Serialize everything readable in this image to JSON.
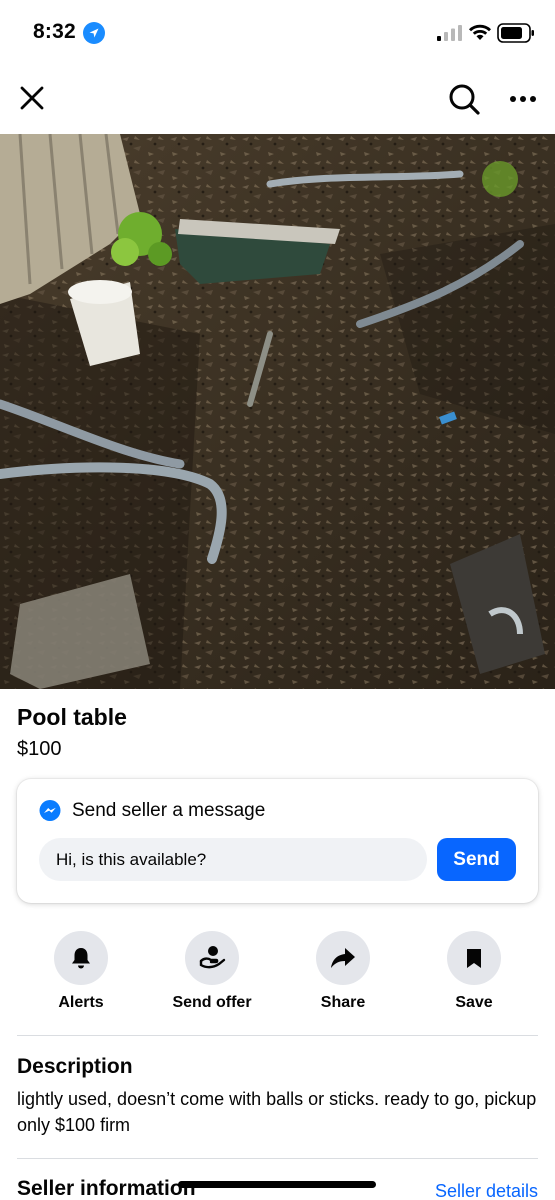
{
  "status_bar": {
    "time": "8:32",
    "icons": [
      "location-arrow-icon",
      "cellular-signal-icon",
      "wifi-icon",
      "battery-icon"
    ]
  },
  "top_bar": {
    "icons": [
      "close-icon",
      "search-icon",
      "more-icon"
    ]
  },
  "listing": {
    "photo_description_icon": "listing-photo",
    "title": "Pool table",
    "price": "$100"
  },
  "message_card": {
    "title": "Send seller a message",
    "input_value": "Hi, is this available?",
    "send_label": "Send",
    "icon": "messenger-icon"
  },
  "actions": [
    {
      "label": "Alerts",
      "icon": "bell-icon"
    },
    {
      "label": "Send offer",
      "icon": "offer-hand-icon"
    },
    {
      "label": "Share",
      "icon": "share-arrow-icon"
    },
    {
      "label": "Save",
      "icon": "bookmark-icon"
    }
  ],
  "description": {
    "title": "Description",
    "text": "lightly used, doesn’t come with balls or sticks. ready to go, pickup only $100 firm"
  },
  "seller": {
    "title": "Seller information",
    "link": "Seller details"
  },
  "colors": {
    "accent": "#0866ff",
    "button_bg": "#e4e6eb",
    "input_bg": "#f0f2f5"
  }
}
